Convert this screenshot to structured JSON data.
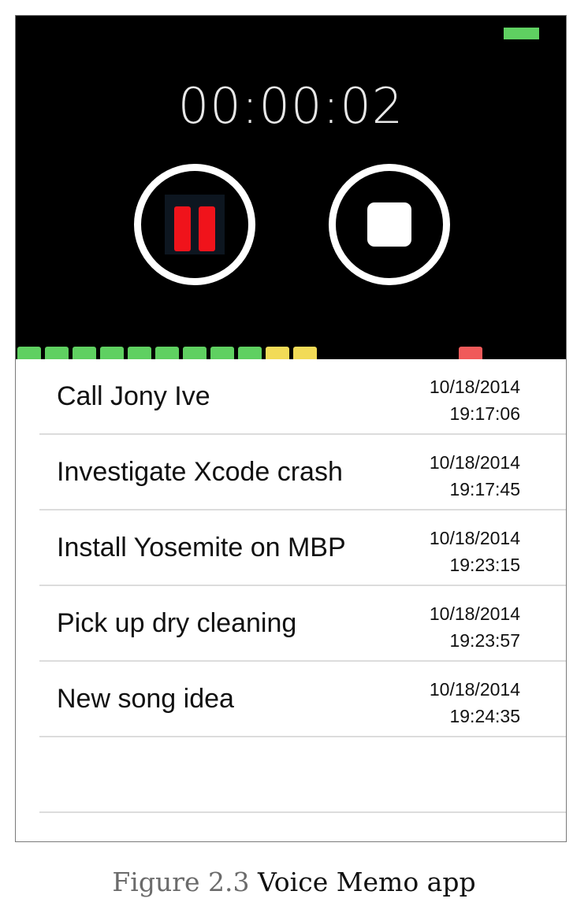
{
  "recorder": {
    "elapsed": "00:00:02",
    "battery_color": "#5fd061",
    "controls": {
      "pause_icon": "pause-icon",
      "stop_icon": "stop-icon",
      "accent_red": "#f0131b"
    },
    "level_meter": {
      "segments": [
        {
          "color": "#5fd061"
        },
        {
          "color": "#5fd061"
        },
        {
          "color": "#5fd061"
        },
        {
          "color": "#5fd061"
        },
        {
          "color": "#5fd061"
        },
        {
          "color": "#5fd061"
        },
        {
          "color": "#5fd061"
        },
        {
          "color": "#5fd061"
        },
        {
          "color": "#5fd061"
        },
        {
          "color": "#f2db57"
        },
        {
          "color": "#f2db57"
        }
      ],
      "peak_color": "#f05a5a"
    }
  },
  "memos": [
    {
      "title": "Call Jony Ive",
      "date": "10/18/2014",
      "time": "19:17:06"
    },
    {
      "title": "Investigate Xcode crash",
      "date": "10/18/2014",
      "time": "19:17:45"
    },
    {
      "title": "Install Yosemite on MBP",
      "date": "10/18/2014",
      "time": "19:23:15"
    },
    {
      "title": "Pick up dry cleaning",
      "date": "10/18/2014",
      "time": "19:23:57"
    },
    {
      "title": "New song idea",
      "date": "10/18/2014",
      "time": "19:24:35"
    }
  ],
  "caption": {
    "label": "Figure 2.3",
    "text": "Voice Memo app"
  }
}
